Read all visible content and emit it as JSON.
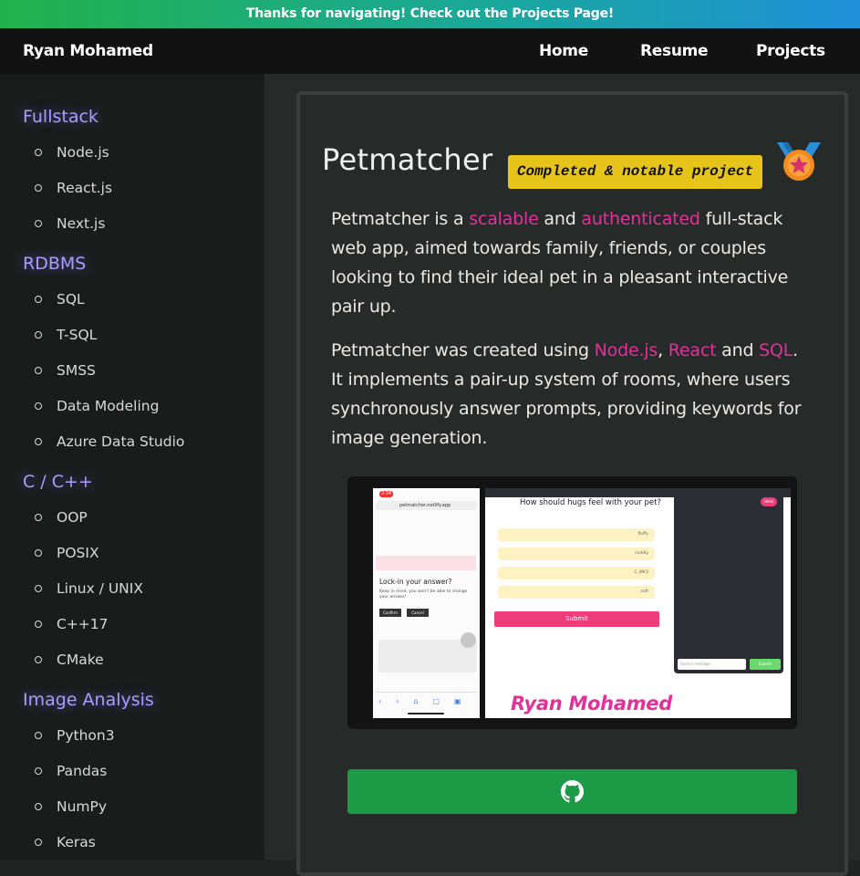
{
  "banner": {
    "text": "Thanks for navigating! Check out the Projects Page!"
  },
  "nav": {
    "brand": "Ryan Mohamed",
    "links": [
      "Home",
      "Resume",
      "Projects"
    ]
  },
  "sidebar": {
    "sections": [
      {
        "title": "Fullstack",
        "items": [
          "Node.js",
          "React.js",
          "Next.js"
        ]
      },
      {
        "title": "RDBMS",
        "items": [
          "SQL",
          "T-SQL",
          "SMSS",
          "Data Modeling",
          "Azure Data Studio"
        ]
      },
      {
        "title": "C / C++",
        "items": [
          "OOP",
          "POSIX",
          "Linux / UNIX",
          "C++17",
          "CMake"
        ]
      },
      {
        "title": "Image Analysis",
        "items": [
          "Python3",
          "Pandas",
          "NumPy",
          "Keras"
        ]
      }
    ]
  },
  "project": {
    "title": "Petmatcher",
    "badge": "Completed & notable project",
    "medal_icon": "medal-icon",
    "p1": {
      "a": "Petmatcher is a ",
      "scalable": "scalable",
      "b": " and ",
      "authenticated": "authenticated",
      "c": " full-stack web app, aimed towards family, friends, or couples looking to find their ideal pet in a pleasant interactive pair up."
    },
    "p2": {
      "a": "Petmatcher was created using ",
      "node": "Node.js",
      "comma": ", ",
      "react": "React",
      "and": " and ",
      "sql": "SQL",
      "c": ". It implements a pair-up system of rooms, where users synchronously answer prompts, providing keywords for image generation."
    },
    "screenshot": {
      "phone_url": "petmatcher.netlify.app",
      "phone_time": "2:34",
      "phone_heading": "Lock-in your answer?",
      "phone_text": "Keep in mind, you won't be able to change your answer!",
      "phone_confirm": "Confirm",
      "phone_cancel": "Cancel",
      "tablet_question": "How should hugs feel with your pet?",
      "tablet_options": [
        "fluffy",
        "cuddly",
        "C_WK3",
        "soft"
      ],
      "tablet_submit": "Submit",
      "chat_placeholder": "Send a message",
      "chat_submit": "Submit",
      "chat_bubble": "Hello",
      "signature": "Ryan Mohamed"
    },
    "github_icon": "github-icon",
    "accent": "#e0329a",
    "button_color": "#1c9a45"
  }
}
